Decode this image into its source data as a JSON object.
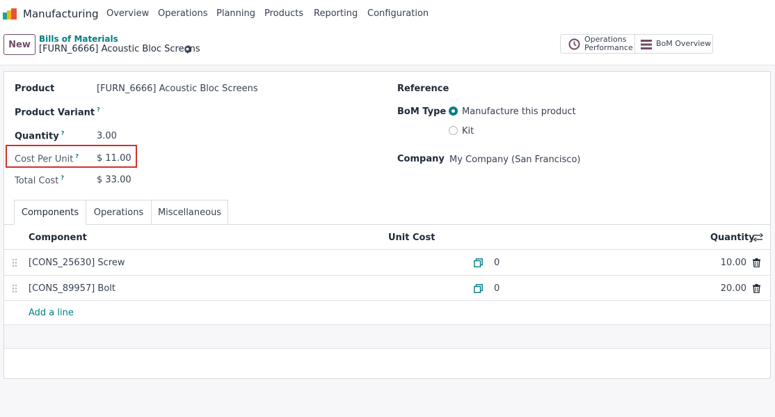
{
  "navbar": {
    "app_name": "Manufacturing",
    "menu": [
      "Overview",
      "Operations",
      "Planning",
      "Products",
      "Reporting",
      "Configuration"
    ],
    "logo_icon": "manufacturing-app-icon"
  },
  "control_panel": {
    "new_label": "New",
    "breadcrumb": "Bills of Materials",
    "record_title": "[FURN_6666] Acoustic Bloc Screens",
    "smart_buttons": {
      "ops_perf_line1": "Operations",
      "ops_perf_line2": "Performance",
      "bom_overview": "BoM Overview"
    }
  },
  "form": {
    "product_label": "Product",
    "product_value": "[FURN_6666] Acoustic Bloc Screens",
    "variant_label": "Product Variant",
    "quantity_label": "Quantity",
    "quantity_value": "3.00",
    "cost_unit_label": "Cost Per Unit",
    "cost_unit_value": "$ 11.00",
    "total_cost_label": "Total Cost",
    "total_cost_value": "$ 33.00",
    "help_mark": "?",
    "reference_label": "Reference",
    "bom_type_label": "BoM Type",
    "bom_type_options": [
      "Manufacture this product",
      "Kit"
    ],
    "bom_type_selected": "Manufacture this product",
    "company_label": "Company",
    "company_value": "My Company (San Francisco)"
  },
  "tabs": [
    "Components",
    "Operations",
    "Miscellaneous"
  ],
  "table": {
    "headers": {
      "component": "Component",
      "unit_cost": "Unit Cost",
      "quantity": "Quantity"
    },
    "rows": [
      {
        "component": "[CONS_25630] Screw",
        "unit_cost": "0",
        "quantity": "10.00"
      },
      {
        "component": "[CONS_89957] Bolt",
        "unit_cost": "0",
        "quantity": "20.00"
      }
    ],
    "add_line": "Add a line"
  },
  "colors": {
    "brand": "#714b67",
    "accent": "#017e84",
    "highlight": "#d32f2f"
  }
}
